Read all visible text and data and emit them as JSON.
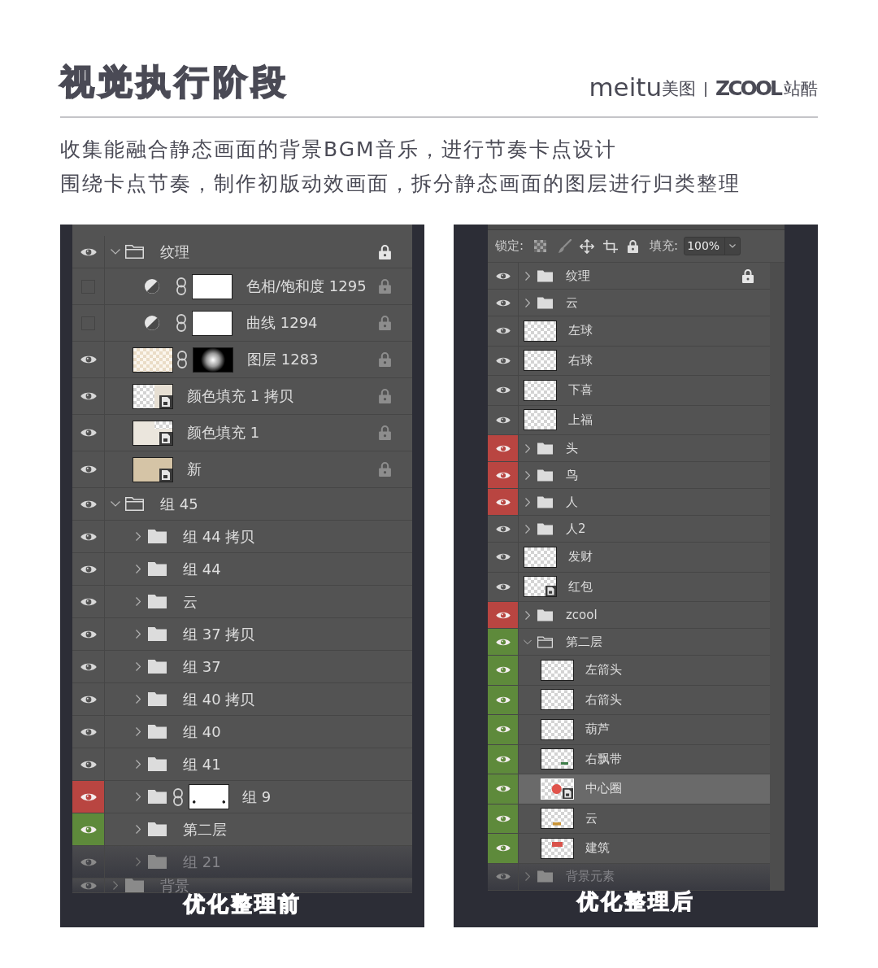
{
  "title": "视觉执行阶段",
  "logos": {
    "first_wordmark": "meitu",
    "first_name": "美图",
    "second_wordmark": "ZCOOL",
    "second_name": "站酷"
  },
  "description": [
    "收集能融合静态画面的背景BGM音乐，进行节奏卡点设计",
    "围绕卡点节奏，制作初版动效画面，拆分静态画面的图层进行归类整理"
  ],
  "panels": [
    {
      "caption": "优化整理前",
      "layers": [
        {
          "name": "纹理",
          "kind": "group",
          "expanded": true,
          "visible": true,
          "selected": false,
          "faded": false,
          "locked": true,
          "lock_greyed": false,
          "children": [
            {
              "name": "色相/饱和度 1295",
              "kind": "adjustment",
              "mask": {
                "kind": "white"
              },
              "visible": false,
              "selected": false,
              "faded": false,
              "locked": true,
              "lock_greyed": true
            },
            {
              "name": "曲线 1294",
              "kind": "adjustment",
              "mask": {
                "kind": "white"
              },
              "visible": false,
              "selected": false,
              "faded": false,
              "locked": true,
              "lock_greyed": true
            },
            {
              "name": "图层 1283",
              "kind": "pixel",
              "thumb": {
                "kind": "tinted"
              },
              "mask": {
                "kind": "radial"
              },
              "visible": true,
              "selected": false,
              "faded": false,
              "locked": true,
              "lock_greyed": true
            },
            {
              "name": "颜色填充 1 拷贝",
              "kind": "smart",
              "thumb": {
                "kind": "split"
              },
              "visible": true,
              "selected": false,
              "faded": false,
              "locked": true,
              "lock_greyed": true
            },
            {
              "name": "颜色填充 1",
              "kind": "smart",
              "thumb": {
                "kind": "paper"
              },
              "visible": true,
              "selected": false,
              "faded": false,
              "locked": true,
              "lock_greyed": true
            },
            {
              "name": "新",
              "kind": "smart",
              "thumb": {
                "kind": "beige"
              },
              "visible": true,
              "selected": false,
              "faded": false,
              "locked": true,
              "lock_greyed": true
            }
          ]
        },
        {
          "name": "组 45",
          "kind": "group",
          "expanded": true,
          "visible": true,
          "selected": false,
          "faded": false,
          "locked": false,
          "children": [
            {
              "name": "组 44 拷贝",
              "kind": "group",
              "expanded": false,
              "visible": true,
              "selected": false,
              "faded": false,
              "locked": false
            },
            {
              "name": "组 44",
              "kind": "group",
              "expanded": false,
              "visible": true,
              "selected": false,
              "faded": false,
              "locked": false
            },
            {
              "name": "云",
              "kind": "group",
              "expanded": false,
              "visible": true,
              "selected": false,
              "faded": false,
              "locked": false
            },
            {
              "name": "组 37 拷贝",
              "kind": "group",
              "expanded": false,
              "visible": true,
              "selected": false,
              "faded": false,
              "locked": false
            },
            {
              "name": "组 37",
              "kind": "group",
              "expanded": false,
              "visible": true,
              "selected": false,
              "faded": false,
              "locked": false
            },
            {
              "name": "组 40 拷贝",
              "kind": "group",
              "expanded": false,
              "visible": true,
              "selected": false,
              "faded": false,
              "locked": false
            },
            {
              "name": "组 40",
              "kind": "group",
              "expanded": false,
              "visible": true,
              "selected": false,
              "faded": false,
              "locked": false
            },
            {
              "name": "组 41",
              "kind": "group",
              "expanded": false,
              "visible": true,
              "selected": false,
              "faded": false,
              "locked": false
            },
            {
              "name": "组 9",
              "kind": "group",
              "expanded": false,
              "mask": {
                "kind": "dotted"
              },
              "color": "#b94541",
              "visible": true,
              "selected": false,
              "faded": false,
              "locked": false
            },
            {
              "name": "第二层",
              "kind": "group",
              "expanded": false,
              "color": "#5e8a3b",
              "visible": true,
              "selected": false,
              "faded": false,
              "locked": false
            },
            {
              "name": "组 21",
              "kind": "group",
              "expanded": false,
              "visible": true,
              "selected": false,
              "faded": true,
              "locked": false
            }
          ]
        },
        {
          "name": "背景",
          "kind": "group",
          "expanded": false,
          "visible": true,
          "selected": false,
          "faded": true,
          "locked": false
        }
      ]
    },
    {
      "caption": "优化整理后",
      "toolbar": {
        "lock_label": "锁定:",
        "fill_label": "填充:",
        "fill_value": "100%"
      },
      "layers": [
        {
          "name": "纹理",
          "kind": "group",
          "expanded": false,
          "visible": true,
          "selected": false,
          "faded": false,
          "locked": true,
          "lock_greyed": false
        },
        {
          "name": "云",
          "kind": "group",
          "expanded": false,
          "visible": true,
          "selected": false,
          "faded": false,
          "locked": false
        },
        {
          "name": "左球",
          "kind": "pixel",
          "thumb": {
            "kind": "checker"
          },
          "visible": true,
          "selected": false,
          "faded": false,
          "locked": false
        },
        {
          "name": "右球",
          "kind": "pixel",
          "thumb": {
            "kind": "checker"
          },
          "visible": true,
          "selected": false,
          "faded": false,
          "locked": false
        },
        {
          "name": "下喜",
          "kind": "pixel",
          "thumb": {
            "kind": "checker"
          },
          "visible": true,
          "selected": false,
          "faded": false,
          "locked": false
        },
        {
          "name": "上福",
          "kind": "pixel",
          "thumb": {
            "kind": "checker"
          },
          "visible": true,
          "selected": false,
          "faded": false,
          "locked": false
        },
        {
          "name": "头",
          "kind": "group",
          "expanded": false,
          "color": "#b94541",
          "visible": true,
          "selected": false,
          "faded": false,
          "locked": false
        },
        {
          "name": "鸟",
          "kind": "group",
          "expanded": false,
          "color": "#b94541",
          "visible": true,
          "selected": false,
          "faded": false,
          "locked": false
        },
        {
          "name": "人",
          "kind": "group",
          "expanded": false,
          "color": "#b94541",
          "visible": true,
          "selected": false,
          "faded": false,
          "locked": false
        },
        {
          "name": "人2",
          "kind": "group",
          "expanded": false,
          "visible": true,
          "selected": false,
          "faded": false,
          "locked": false
        },
        {
          "name": "发财",
          "kind": "pixel",
          "thumb": {
            "kind": "checker"
          },
          "visible": true,
          "selected": false,
          "faded": false,
          "locked": false
        },
        {
          "name": "红包",
          "kind": "smart",
          "thumb": {
            "kind": "checker"
          },
          "visible": true,
          "selected": false,
          "faded": false,
          "locked": false
        },
        {
          "name": "zcool",
          "kind": "group",
          "expanded": false,
          "color": "#b94541",
          "visible": true,
          "selected": false,
          "faded": false,
          "locked": false
        },
        {
          "name": "第二层",
          "kind": "group",
          "expanded": true,
          "color": "#5e8a3b",
          "visible": true,
          "selected": false,
          "faded": false,
          "locked": false,
          "children": [
            {
              "name": "左箭头",
              "kind": "pixel",
              "thumb": {
                "kind": "checker"
              },
              "color": "#5e8a3b",
              "visible": true,
              "selected": false,
              "faded": false,
              "locked": false
            },
            {
              "name": "右箭头",
              "kind": "pixel",
              "thumb": {
                "kind": "checker"
              },
              "color": "#5e8a3b",
              "visible": true,
              "selected": false,
              "faded": false,
              "locked": false
            },
            {
              "name": "葫芦",
              "kind": "pixel",
              "thumb": {
                "kind": "checker"
              },
              "color": "#5e8a3b",
              "visible": true,
              "selected": false,
              "faded": false,
              "locked": false
            },
            {
              "name": "右飘带",
              "kind": "pixel",
              "thumb": {
                "kind": "ribbon"
              },
              "color": "#5e8a3b",
              "visible": true,
              "selected": false,
              "faded": false,
              "locked": false
            },
            {
              "name": "中心圈",
              "kind": "smart",
              "thumb": {
                "kind": "disc"
              },
              "color": "#5e8a3b",
              "visible": true,
              "selected": true,
              "faded": false,
              "locked": false
            },
            {
              "name": "云",
              "kind": "pixel",
              "thumb": {
                "kind": "smudge"
              },
              "color": "#5e8a3b",
              "visible": true,
              "selected": false,
              "faded": false,
              "locked": false
            },
            {
              "name": "建筑",
              "kind": "pixel",
              "thumb": {
                "kind": "banner"
              },
              "color": "#5e8a3b",
              "visible": true,
              "selected": false,
              "faded": false,
              "locked": false
            }
          ]
        },
        {
          "name": "背景元素",
          "kind": "group",
          "expanded": false,
          "visible": true,
          "selected": false,
          "faded": true,
          "locked": false
        }
      ]
    }
  ]
}
